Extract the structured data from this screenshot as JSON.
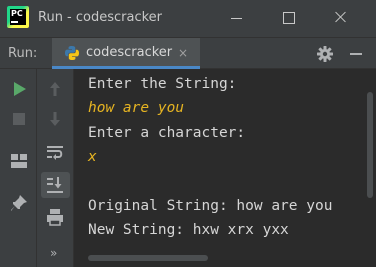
{
  "window": {
    "title": "Run - codescracker",
    "logo_text": "PC"
  },
  "run_panel": {
    "label": "Run:",
    "tab_label": "codescracker",
    "tab_close": "×"
  },
  "left_toolbar": {
    "expand_label": "»"
  },
  "console": {
    "lines": [
      {
        "text": "Enter the String:",
        "kind": "output"
      },
      {
        "text": "how are you",
        "kind": "input"
      },
      {
        "text": "Enter a character:",
        "kind": "output"
      },
      {
        "text": "x",
        "kind": "input"
      },
      {
        "text": "",
        "kind": "output"
      },
      {
        "text": "Original String: how are you",
        "kind": "output"
      },
      {
        "text": "New String: hxw xrx yxx",
        "kind": "output"
      }
    ]
  },
  "colors": {
    "run_green": "#59a869",
    "input_text": "#e6b422",
    "tab_underline": "#4a88c7"
  },
  "icons": [
    "run-icon",
    "stop-icon",
    "up-arrow-icon",
    "down-arrow-icon",
    "soft-wrap-icon",
    "layout-icon",
    "scroll-to-end-icon",
    "pin-icon",
    "print-icon",
    "gear-icon",
    "python-file-icon"
  ]
}
